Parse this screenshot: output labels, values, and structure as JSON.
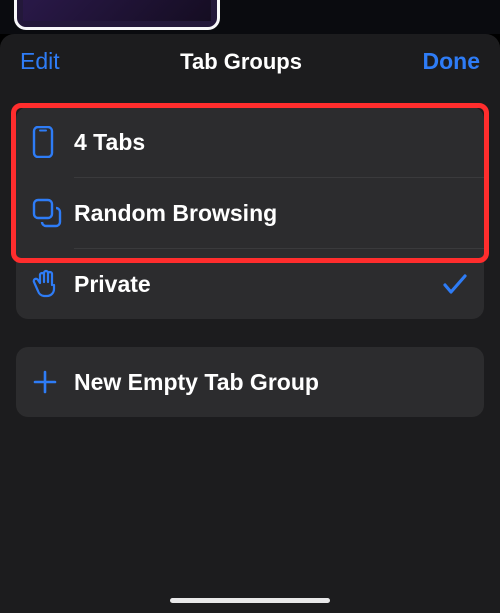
{
  "header": {
    "edit_label": "Edit",
    "title": "Tab Groups",
    "done_label": "Done"
  },
  "groups": {
    "tabs_item_label": "4 Tabs",
    "random_item_label": "Random Browsing",
    "private_item_label": "Private"
  },
  "actions": {
    "new_group_label": "New Empty Tab Group"
  },
  "icons": {
    "phone": "phone-icon",
    "squares": "squares-icon",
    "hand": "hand-icon",
    "plus": "plus-icon",
    "check": "check-icon"
  },
  "colors": {
    "accent": "#2e7cf6",
    "highlight": "#ff2d2d"
  }
}
